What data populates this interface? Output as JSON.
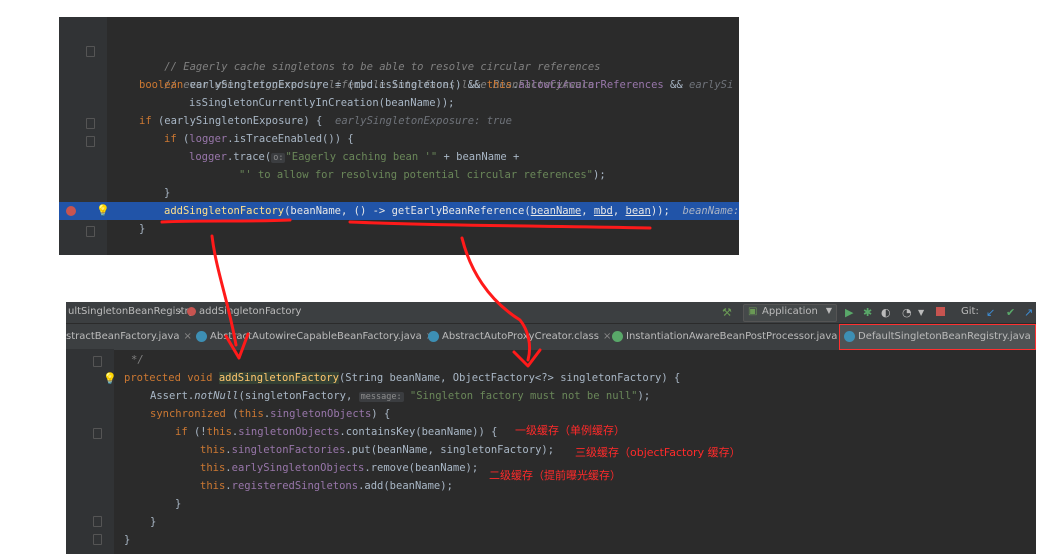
{
  "top": {
    "comment1": "// Eagerly cache singletons to be able to resolve circular references",
    "comment2": "// even when triggered by lifecycle interfaces like BeanFactoryAware.",
    "l3_kw": "boolean ",
    "l3_a": "earlySingletonExposure = (mbd.isSingleton() && ",
    "l3_this": "this",
    "l3_b": ".",
    "l3_field": "allowCircularReferences",
    "l3_c": " && ",
    "l3_hint": "earlySi",
    "l4": "isSingletonCurrentlyInCreation(beanName));",
    "l5_kw": "if ",
    "l5_a": "(earlySingletonExposure) {",
    "l5_hint": "earlySingletonExposure: true",
    "l6_kw": "if ",
    "l6_a": "(",
    "l6_field": "logger",
    "l6_b": ".isTraceEnabled()) {",
    "l7_field": "logger",
    "l7_a": ".trace(",
    "l7_param": "o:",
    "l7_str": "\"Eagerly caching bean '\"",
    "l7_b": " + beanName +",
    "l8_str": "\"' to allow for resolving potential circular references\"",
    "l8_a": ");",
    "l9": "}",
    "l10_fn": "addSingletonFactory",
    "l10_a": "(beanName,",
    "l10_b": " () -> getEarlyBeanReference(",
    "l10_p1": "beanName",
    "l10_c": ", ",
    "l10_p2": "mbd",
    "l10_d": ", ",
    "l10_p3": "bean",
    "l10_e": "));",
    "l10_hint": "beanName: \"",
    "l11": "}"
  },
  "bottom": {
    "breadcrumb_class": "ultSingletonBeanRegistry",
    "breadcrumb_sep": "›",
    "breadcrumb_method": "addSingletonFactory",
    "run_config": "Application",
    "vcs_label": "Git:",
    "tabs": [
      {
        "label": "stractBeanFactory.java"
      },
      {
        "label": "AbstractAutowireCapableBeanFactory.java"
      },
      {
        "label": "AbstractAutoProxyCreator.class"
      },
      {
        "label": "InstantiationAwareBeanPostProcessor.java"
      },
      {
        "label": "DefaultSingletonBeanRegistry.java"
      }
    ],
    "b1": "*/",
    "b2_kw": "protected void ",
    "b2_fn": "addSingletonFactory",
    "b2_a": "(String beanName, ObjectFactory<?> singletonFactory) {",
    "b3_a": "Assert.",
    "b3_fn": "notNull",
    "b3_b": "(singletonFactory, ",
    "b3_param": "message:",
    "b3_str": " \"Singleton factory must not be null\"",
    "b3_c": ");",
    "b4_kw": "synchronized ",
    "b4_a": "(",
    "b4_this": "this",
    "b4_b": ".",
    "b4_field": "singletonObjects",
    "b4_c": ") {",
    "b5_kw": "if ",
    "b5_a": "(!",
    "b5_this": "this",
    "b5_b": ".",
    "b5_field": "singletonObjects",
    "b5_c": ".containsKey(beanName)) {",
    "b6_this": "this",
    "b6_b": ".",
    "b6_field": "singletonFactories",
    "b6_c": ".put(beanName, singletonFactory);",
    "b7_this": "this",
    "b7_b": ".",
    "b7_field": "earlySingletonObjects",
    "b7_c": ".remove(beanName);",
    "b8_this": "this",
    "b8_b": ".",
    "b8_field": "registeredSingletons",
    "b8_c": ".add(beanName);",
    "b9": "}",
    "b10": "}",
    "b11": "}"
  },
  "annotations": {
    "level1": "一级缓存（单例缓存）",
    "level3": "三级缓存（objectFactory 缓存）",
    "level2": "二级缓存（提前曝光缓存）"
  },
  "colors": {
    "editor_bg": "#2b2b2b",
    "annotation": "#ff2a2a",
    "selection": "#2154a8"
  }
}
